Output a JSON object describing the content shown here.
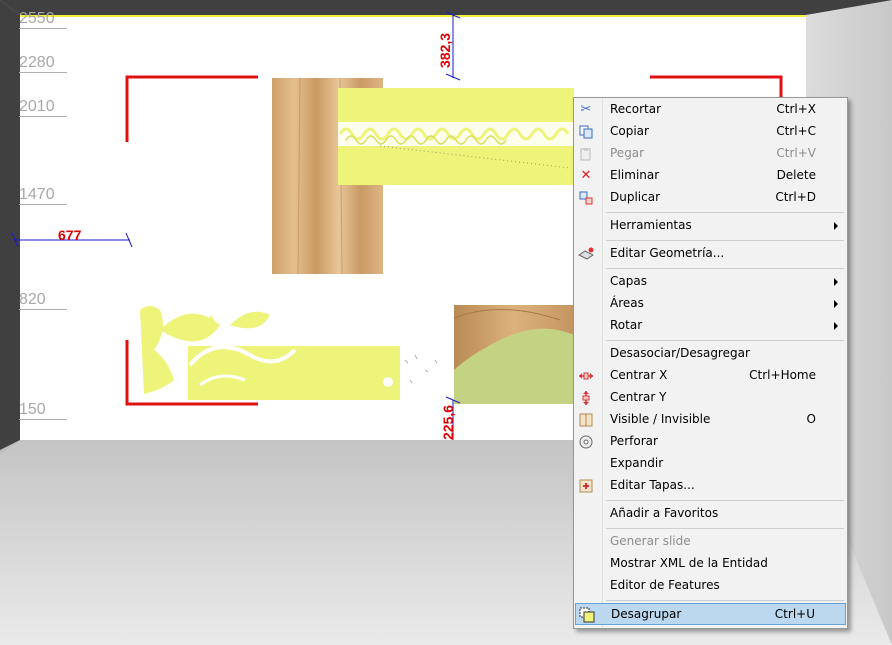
{
  "ruler": {
    "heights": [
      "2550",
      "2280",
      "2010",
      "1470",
      "820",
      "150"
    ]
  },
  "dimensions": {
    "top_gap": "382,3",
    "left_gap": "677",
    "bottom_gap": "225,6"
  },
  "context_menu": {
    "items": [
      {
        "label": "Recortar",
        "shortcut": "Ctrl+X",
        "icon": "scissors-icon"
      },
      {
        "label": "Copiar",
        "shortcut": "Ctrl+C",
        "icon": "copy-icon"
      },
      {
        "label": "Pegar",
        "shortcut": "Ctrl+V",
        "icon": "paste-icon"
      },
      {
        "label": "Eliminar",
        "shortcut": "Delete",
        "icon": "delete-icon"
      },
      {
        "label": "Duplicar",
        "shortcut": "Ctrl+D",
        "icon": "duplicate-icon"
      },
      {
        "label": "Herramientas"
      },
      {
        "label": "Editar Geometría...",
        "icon": "edit-geometry-icon"
      },
      {
        "label": "Capas"
      },
      {
        "label": "Áreas"
      },
      {
        "label": "Rotar"
      },
      {
        "label": "Desasociar/Desagregar"
      },
      {
        "label": "Centrar X",
        "shortcut": "Ctrl+Home",
        "icon": "center-x-icon"
      },
      {
        "label": "Centrar Y",
        "icon": "center-y-icon"
      },
      {
        "label": "Visible / Invisible",
        "shortcut": "O",
        "icon": "visibility-icon"
      },
      {
        "label": "Perforar",
        "icon": "drill-icon"
      },
      {
        "label": "Expandir"
      },
      {
        "label": "Editar Tapas...",
        "icon": "edit-caps-icon"
      },
      {
        "label": "Añadir a Favoritos"
      },
      {
        "label": "Generar slide"
      },
      {
        "label": "Mostrar XML de la Entidad"
      },
      {
        "label": "Editor de Features"
      },
      {
        "label": "Desagrupar",
        "shortcut": "Ctrl+U",
        "icon": "ungroup-icon"
      }
    ],
    "disabled": [
      "Pegar",
      "Generar slide"
    ],
    "selected": "Desagrupar"
  },
  "colors": {
    "dimension_red": "#e00000",
    "dimension_blue": "#1a1acc",
    "panel_yellow": "#eef47a",
    "panel_green": "#c3d383",
    "wood": "#d9b07a",
    "menu_bg": "#f2f2f2",
    "menu_highlight": "#bcd8ef"
  }
}
